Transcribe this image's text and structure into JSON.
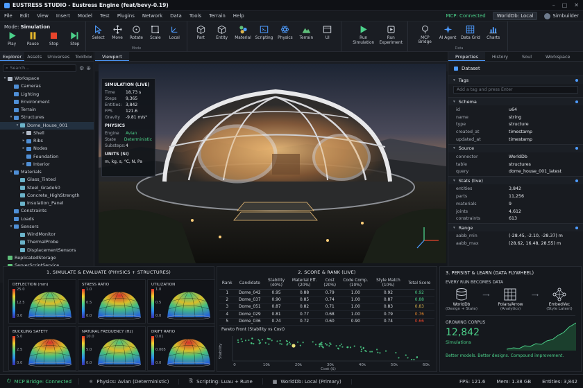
{
  "window": {
    "title": "EUSTRESS STUDIO - Eustress Engine (feat/bevy-0.19)"
  },
  "menu": [
    "File",
    "Edit",
    "View",
    "Insert",
    "Model",
    "Test",
    "Plugins",
    "Network",
    "Data",
    "Tools",
    "Terrain",
    "Help"
  ],
  "menu_right": {
    "mcp": "MCP: Connected",
    "worlddb": "WorldDb: Local",
    "user": "Simbuilder"
  },
  "ribbon": {
    "mode_label": "Mode:",
    "mode_value": "Simulation",
    "play": [
      "Play",
      "Pause",
      "Stop",
      "Step"
    ],
    "tools": [
      "Select",
      "Move",
      "Rotate",
      "Scale",
      "Local"
    ],
    "tools_caption": "Mode",
    "insert": [
      "Part",
      "Entity",
      "Material",
      "Scripting",
      "Physics",
      "Terrain",
      "UI"
    ],
    "sim": [
      "Run\nSimulation",
      "Run\nExperiment"
    ],
    "data": [
      "MCP Bridge",
      "AI Agent",
      "Data Grid",
      "Charts"
    ],
    "data_caption": "Data"
  },
  "left": {
    "tabs": [
      "Explorer",
      "Assets",
      "Universes",
      "Toolbox"
    ],
    "search_placeholder": "Search...",
    "tree": [
      {
        "label": "Workspace",
        "d": 0,
        "car": "▾",
        "ic": "cube"
      },
      {
        "label": "Cameras",
        "d": 1,
        "car": "",
        "ic": "fold"
      },
      {
        "label": "Lighting",
        "d": 1,
        "car": "",
        "ic": "fold"
      },
      {
        "label": "Environment",
        "d": 1,
        "car": "",
        "ic": "fold"
      },
      {
        "label": "Terrain",
        "d": 1,
        "car": "",
        "ic": "fold"
      },
      {
        "label": "Structures",
        "d": 1,
        "car": "▾",
        "ic": "fold"
      },
      {
        "label": "Dome_House_001",
        "d": 2,
        "car": "▾",
        "ic": "pkg",
        "sel": true
      },
      {
        "label": "Shell",
        "d": 3,
        "car": "▸",
        "ic": "cube"
      },
      {
        "label": "Ribs",
        "d": 3,
        "car": "▸",
        "ic": "fold"
      },
      {
        "label": "Nodes",
        "d": 3,
        "car": "▸",
        "ic": "fold"
      },
      {
        "label": "Foundation",
        "d": 3,
        "car": "",
        "ic": "fold"
      },
      {
        "label": "Interior",
        "d": 3,
        "car": "▸",
        "ic": "fold"
      },
      {
        "label": "Materials",
        "d": 1,
        "car": "▾",
        "ic": "fold"
      },
      {
        "label": "Glass_Tinted",
        "d": 2,
        "car": "",
        "ic": "pkg"
      },
      {
        "label": "Steel_Grade50",
        "d": 2,
        "car": "",
        "ic": "pkg"
      },
      {
        "label": "Concrete_HighStrength",
        "d": 2,
        "car": "",
        "ic": "pkg"
      },
      {
        "label": "Insulation_Panel",
        "d": 2,
        "car": "",
        "ic": "pkg"
      },
      {
        "label": "Constraints",
        "d": 1,
        "car": "",
        "ic": "fold"
      },
      {
        "label": "Loads",
        "d": 1,
        "car": "",
        "ic": "fold"
      },
      {
        "label": "Sensors",
        "d": 1,
        "car": "▾",
        "ic": "fold"
      },
      {
        "label": "WindMonitor",
        "d": 2,
        "car": "",
        "ic": "pkg"
      },
      {
        "label": "ThermalProbe",
        "d": 2,
        "car": "",
        "ic": "pkg"
      },
      {
        "label": "DisplacementSensors",
        "d": 2,
        "car": "",
        "ic": "pkg"
      },
      {
        "label": "ReplicatedStorage",
        "d": 0,
        "car": "",
        "ic": "grn"
      },
      {
        "label": "ServerScriptService",
        "d": 0,
        "car": "",
        "ic": "grn"
      },
      {
        "label": "ServerStorage",
        "d": 0,
        "car": "",
        "ic": "grn"
      },
      {
        "label": "DataService",
        "d": 0,
        "car": "",
        "ic": "yel"
      }
    ]
  },
  "viewport": {
    "tab": "Viewport"
  },
  "sim_overlay": {
    "title": "SIMULATION (LIVE)",
    "rows": [
      [
        "Time",
        "18.73 s"
      ],
      [
        "Steps",
        "9,365"
      ],
      [
        "Entities:",
        "3,842"
      ],
      [
        "FPS",
        "121.6"
      ],
      [
        "Gravity",
        "-9.81 m/s²"
      ]
    ],
    "physics_title": "PHYSICS",
    "physics": [
      [
        "Engine",
        "Avian"
      ],
      [
        "State",
        "Deterministic"
      ],
      [
        "Substeps:",
        "4"
      ]
    ],
    "units_title": "UNITS (SI)",
    "units": "m, kg, s, °C, N, Pa"
  },
  "right": {
    "tabs": [
      "Properties",
      "History",
      "Soul",
      "Workspace"
    ],
    "dataset": "Dataset",
    "tags_title": "Tags",
    "tags_placeholder": "Add a tag and press Enter",
    "schema_title": "Schema",
    "schema": [
      [
        "id",
        "u64"
      ],
      [
        "name",
        "string"
      ],
      [
        "type",
        "structure"
      ],
      [
        "created_at",
        "timestamp"
      ],
      [
        "updated_at",
        "timestamp"
      ]
    ],
    "source_title": "Source",
    "source": [
      [
        "connector",
        "WorldDb"
      ],
      [
        "table",
        "structures"
      ],
      [
        "query",
        "dome_house_001_latest"
      ]
    ],
    "stats_title": "Stats (live)",
    "stats": [
      [
        "entities",
        "3,842"
      ],
      [
        "parts",
        "11,256"
      ],
      [
        "materials",
        "9"
      ],
      [
        "joints",
        "4,612"
      ],
      [
        "constraints",
        "613"
      ]
    ],
    "range_title": "Range",
    "range": [
      [
        "aabb_min",
        "(-28.45, -2.10, -28.37) m"
      ],
      [
        "aabb_max",
        "(28.62, 16.48, 28.55) m"
      ]
    ]
  },
  "panel1": {
    "title": "1. SIMULATE & EVALUATE (PHYSICS + STRUCTURES)",
    "maps": [
      {
        "label": "DEFLECTION (mm)",
        "ticks": [
          "25.0",
          "12.5",
          "0.0"
        ]
      },
      {
        "label": "STRESS RATIO",
        "ticks": [
          "1.0",
          "0.5",
          "0.0"
        ]
      },
      {
        "label": "UTILIZATION",
        "ticks": [
          "1.0",
          "0.5",
          "0.0"
        ]
      },
      {
        "label": "BUCKLING SAFETY",
        "ticks": [
          "5.0",
          "2.5",
          "0.0"
        ]
      },
      {
        "label": "NATURAL FREQUENCY (Hz)",
        "ticks": [
          "10.0",
          "5.0",
          "0.0"
        ]
      },
      {
        "label": "DRIFT RATIO",
        "ticks": [
          "0.01",
          "0.005",
          "0.0"
        ]
      }
    ]
  },
  "panel2": {
    "title": "2. SCORE & RANK (LIVE)",
    "headers": [
      "Rank",
      "Candidate",
      "Stability\n(40%)",
      "Material Eff.\n(20%)",
      "Cost\n(20%)",
      "Code Comp.\n(10%)",
      "Style Match\n(10%)",
      "Total Score"
    ],
    "rows": [
      [
        "1",
        "Dome_042",
        "0.95",
        "0.88",
        "0.79",
        "1.00",
        "0.92",
        "0.92"
      ],
      [
        "2",
        "Dome_037",
        "0.90",
        "0.85",
        "0.74",
        "1.00",
        "0.87",
        "0.88"
      ],
      [
        "3",
        "Dome_051",
        "0.87",
        "0.82",
        "0.71",
        "1.00",
        "0.83",
        "0.83"
      ],
      [
        "4",
        "Dome_029",
        "0.81",
        "0.77",
        "0.68",
        "1.00",
        "0.79",
        "0.76"
      ],
      [
        "5",
        "Dome_036",
        "0.74",
        "0.72",
        "0.60",
        "0.90",
        "0.74",
        "0.66"
      ]
    ],
    "score_colors": [
      "#4cd18a",
      "#4cd18a",
      "#d8b34d",
      "#e8892c",
      "#e8452c"
    ],
    "pareto_title": "Pareto Front  (Stability vs Cost)",
    "pareto_ylabel": "Stability",
    "pareto_xlabel": "Cost ($)",
    "pareto_xticks": [
      "0",
      "10k",
      "20k",
      "30k",
      "40k",
      "50k",
      "60k"
    ]
  },
  "panel3": {
    "title": "3. PERSIST & LEARN (DATA FLYWHEEL)",
    "sub": "EVERY RUN BECOMES DATA",
    "nodes": [
      {
        "name": "WorldDb",
        "sub": "(Design + State)"
      },
      {
        "name": "Polars/Arrow",
        "sub": "(Analytics)"
      },
      {
        "name": "EmbedVec",
        "sub": "(Style Latent)"
      }
    ],
    "corpus_title": "GROWING CORPUS",
    "corpus_value": "12,842",
    "corpus_label": "Simulations",
    "tagline": "Better models. Better designs. Compound improvement."
  },
  "status": [
    {
      "text": "MCP Bridge: Connected",
      "color": "#4cd18a"
    },
    {
      "text": "Physics: Avian (Deterministic)",
      "color": "#c9ced6"
    },
    {
      "text": "Scripting: Luau + Rune",
      "color": "#c9ced6"
    },
    {
      "text": "WorldDb: Local (Primary)",
      "color": "#c9ced6"
    }
  ],
  "status_right": {
    "fps_label": "FPS:",
    "fps": "121.6",
    "mem_label": "Mem:",
    "mem": "1.38 GB",
    "ent_label": "Entities:",
    "ent": "3,842"
  }
}
